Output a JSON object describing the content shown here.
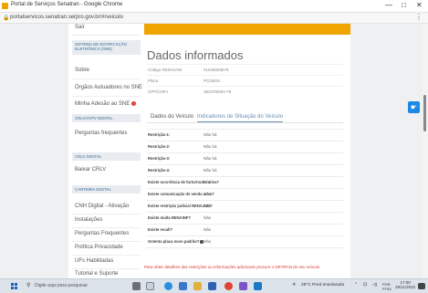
{
  "window": {
    "title": "Portal de Serviços Senatran - Google Chrome",
    "controls": {
      "minimize": "—",
      "maximize": "□",
      "close": "✕"
    }
  },
  "browser": {
    "url": "portalservicos.senatran.serpro.gov.br/#/veiculo",
    "menu_glyph": "⋮"
  },
  "sidebar": {
    "top_item": "Sair",
    "sections": [
      {
        "heading": "SISTEMA DE NOTIFICAÇÃO ELETRÔNICA (SNE)",
        "items": [
          "Sobre",
          "Órgãos Autuadores no SNE",
          "Minha Adesão ao SNE"
        ]
      },
      {
        "heading": "CRLV/ATPV DIGITAL",
        "items": [
          "Perguntas frequentes"
        ]
      },
      {
        "heading": "CRLV DIGITAL",
        "items": [
          "Baixar CRLV"
        ]
      },
      {
        "heading": "CARTEIRA DIGITAL",
        "items": [
          "CNH Digital - Ativação",
          "Instalações",
          "Perguntas Frequentes",
          "Política Privacidade",
          "UFs Habilitadas",
          "Tutorial e Suporte"
        ]
      }
    ],
    "adhesion_badge": "!"
  },
  "main": {
    "title": "Dados informados",
    "info": [
      {
        "label": "Código RENAVAM",
        "value": "01646593675"
      },
      {
        "label": "Placa",
        "value": "PCI3E04"
      },
      {
        "label": "CPF/CNPJ",
        "value": "383375/604-78"
      }
    ],
    "tabs": [
      {
        "label": "Dados do Veículo"
      },
      {
        "label": "Indicadores de Situação do Veículo"
      }
    ],
    "active_tab": "Indicadores de Situação do Veículo",
    "rows": [
      {
        "label": "Restrição-1:",
        "value": "Não há"
      },
      {
        "label": "Restrição-2:",
        "value": "Não há"
      },
      {
        "label": "Restrição-3:",
        "value": "Não há"
      },
      {
        "label": "Restrição-4:",
        "value": "Não há"
      },
      {
        "label": "Existe ocorrência de furto/roubo ativa?",
        "value": "Não"
      },
      {
        "label": "Existe comunicação de venda ativa?",
        "value": "Não"
      },
      {
        "label": "Existe restrição judicial RENAJUD?",
        "value": "Não"
      },
      {
        "label": "Existe multa RENAINF?",
        "value": "Não"
      },
      {
        "label": "Existe recall?",
        "value": "Não"
      },
      {
        "label": "Ostenta placa novo padrão?",
        "value": "Não"
      }
    ],
    "footnote": "Para obter detalhes das restrições ou informações adicionais procure o DETRAN do seu veículo"
  },
  "taskbar": {
    "search_placeholder": "Digite aqui para pesquisar",
    "weather": "29°C  Pred ensolarado",
    "language": "POR\nPTB2",
    "time": "17:00",
    "date": "29/11/2022"
  },
  "colors": {
    "accent_orange": "#f0a400",
    "link_blue": "#6d8fb2",
    "badge_red": "#d9372b",
    "fab_blue": "#1e88e5"
  },
  "icons": {
    "window_icon": "favicon",
    "address_icon": "lock-icon",
    "fab_icon": "hand-pointer-icon",
    "info_icon": "info-circle-icon"
  }
}
